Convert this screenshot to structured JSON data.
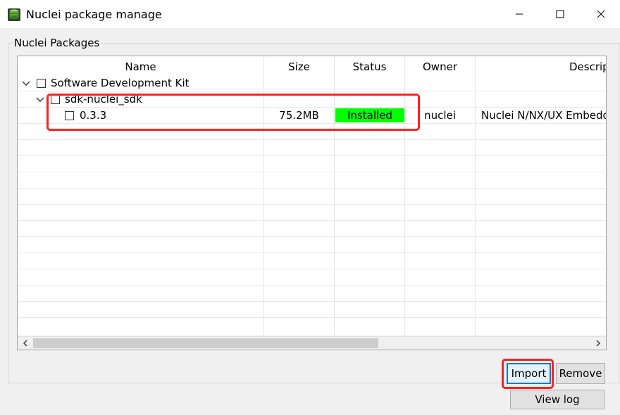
{
  "window": {
    "title": "Nuclei package manage",
    "controls": {
      "minimize": "minimize",
      "maximize": "maximize",
      "close": "close"
    }
  },
  "group": {
    "label": "Nuclei Packages"
  },
  "table": {
    "columns": [
      "Name",
      "Size",
      "Status",
      "Owner",
      "Descrip"
    ],
    "rows": [
      {
        "name": "Software Development Kit",
        "size": "",
        "status": "",
        "owner": "",
        "description": "",
        "expanded": true
      },
      {
        "name": "sdk-nuclei_sdk",
        "size": "",
        "status": "",
        "owner": "",
        "description": "",
        "expanded": true
      },
      {
        "name": "0.3.3",
        "size": "75.2MB",
        "status": "Installed",
        "owner": "nuclei",
        "description": "Nuclei N/NX/UX Embedded"
      }
    ],
    "status_color": "#00ff00"
  },
  "buttons": {
    "import": "Import",
    "remove": "Remove",
    "view_log": "View log"
  },
  "colors": {
    "highlight": "#ff2020",
    "focus": "#0078d7"
  },
  "icons": [
    "database-icon",
    "minimize-icon",
    "maximize-icon",
    "close-icon",
    "chevron-down-icon",
    "checkbox-icon",
    "scroll-left-icon",
    "scroll-right-icon"
  ]
}
